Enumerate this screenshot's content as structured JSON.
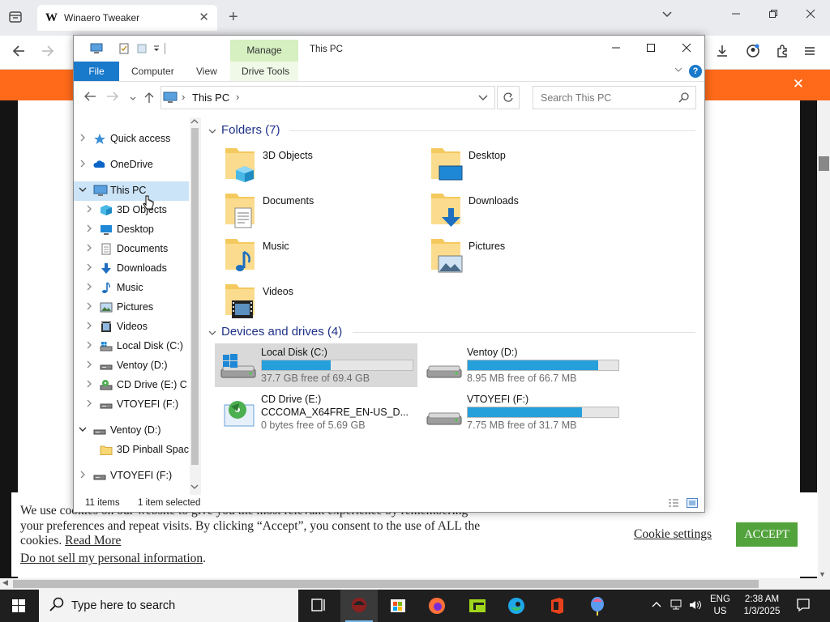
{
  "browser": {
    "tab_title": "Winaero Tweaker",
    "tab_favicon": "W",
    "new_tab": "+",
    "tab_close": "✕",
    "banner_close": "✕"
  },
  "explorer": {
    "title": "This PC",
    "ribbon": {
      "manage": "Manage",
      "file": "File",
      "computer": "Computer",
      "view": "View",
      "drive_tools": "Drive Tools"
    },
    "address": {
      "location": "This PC",
      "separator": "›"
    },
    "search_placeholder": "Search This PC",
    "nav": [
      {
        "label": "Quick access",
        "icon": "star-icon",
        "level": 0,
        "expanded": false
      },
      {
        "label": "OneDrive",
        "icon": "cloud-icon",
        "level": 0,
        "expanded": false
      },
      {
        "label": "This PC",
        "icon": "computer-icon",
        "level": 0,
        "expanded": true,
        "selected": true
      },
      {
        "label": "3D Objects",
        "icon": "cube-icon",
        "level": 1,
        "expanded": false
      },
      {
        "label": "Desktop",
        "icon": "desktop-icon",
        "level": 1,
        "expanded": false
      },
      {
        "label": "Documents",
        "icon": "document-icon",
        "level": 1,
        "expanded": false
      },
      {
        "label": "Downloads",
        "icon": "download-icon",
        "level": 1,
        "expanded": false
      },
      {
        "label": "Music",
        "icon": "music-icon",
        "level": 1,
        "expanded": false
      },
      {
        "label": "Pictures",
        "icon": "picture-icon",
        "level": 1,
        "expanded": false
      },
      {
        "label": "Videos",
        "icon": "video-icon",
        "level": 1,
        "expanded": false
      },
      {
        "label": "Local Disk (C:)",
        "icon": "hard-drive-icon",
        "level": 1,
        "expanded": false
      },
      {
        "label": "Ventoy (D:)",
        "icon": "usb-drive-icon",
        "level": 1,
        "expanded": false
      },
      {
        "label": "CD Drive (E:) C",
        "icon": "cd-drive-icon",
        "level": 1,
        "expanded": false
      },
      {
        "label": "VTOYEFI (F:)",
        "icon": "usb-drive-icon",
        "level": 1,
        "expanded": false
      },
      {
        "label": "Ventoy (D:)",
        "icon": "usb-drive-icon",
        "level": 0,
        "expanded": true
      },
      {
        "label": "3D Pinball Spac",
        "icon": "folder-icon",
        "level": 1,
        "expanded": null
      },
      {
        "label": "VTOYEFI (F:)",
        "icon": "usb-drive-icon",
        "level": 0,
        "expanded": false
      }
    ],
    "folders_header": "Folders (7)",
    "folders": [
      {
        "label": "3D Objects",
        "icon": "cube-folder-icon"
      },
      {
        "label": "Desktop",
        "icon": "desktop-folder-icon"
      },
      {
        "label": "Documents",
        "icon": "documents-folder-icon"
      },
      {
        "label": "Downloads",
        "icon": "downloads-folder-icon"
      },
      {
        "label": "Music",
        "icon": "music-folder-icon"
      },
      {
        "label": "Pictures",
        "icon": "pictures-folder-icon"
      },
      {
        "label": "Videos",
        "icon": "videos-folder-icon"
      }
    ],
    "drives_header": "Devices and drives (4)",
    "drives": [
      {
        "name": "Local Disk (C:)",
        "free": "37.7 GB free of 69.4 GB",
        "used_fraction": 0.457,
        "icon": "windows-drive-icon",
        "selected": true,
        "bar": true
      },
      {
        "name": "Ventoy (D:)",
        "free": "8.95 MB free of 66.7 MB",
        "used_fraction": 0.866,
        "icon": "usb-drive-icon",
        "selected": false,
        "bar": true
      },
      {
        "name": "CD Drive (E:)",
        "name2": "CCCOMA_X64FRE_EN-US_D...",
        "free": "0 bytes free of 5.69 GB",
        "used_fraction": 1.0,
        "icon": "cd-drive-icon",
        "selected": false,
        "bar": false
      },
      {
        "name": "VTOYEFI (F:)",
        "free": "7.75 MB free of 31.7 MB",
        "used_fraction": 0.756,
        "icon": "usb-drive-icon",
        "selected": false,
        "bar": true
      }
    ],
    "status": {
      "items": "11 items",
      "selected": "1 item selected"
    }
  },
  "cookie": {
    "text_line1": "We use cookies on our website to give you the most relevant experience by remembering",
    "text_line2": "your preferences and repeat visits. By clicking “Accept”, you consent to the use of ALL the",
    "text_line3": "cookies.",
    "read_more": "Read More",
    "do_not_sell": "Do not sell my personal information",
    "do_not_sell_period": ".",
    "settings": "Cookie settings",
    "accept": "ACCEPT",
    "accept_color": "#53a33d"
  },
  "taskbar": {
    "search_placeholder": "Type here to search",
    "lang1": "ENG",
    "lang2": "US",
    "time": "2:38 AM",
    "date": "1/3/2025"
  },
  "colors": {
    "accent": "#1979ca",
    "banner": "#ff6a1a",
    "drive_fill": "#26a0da"
  }
}
